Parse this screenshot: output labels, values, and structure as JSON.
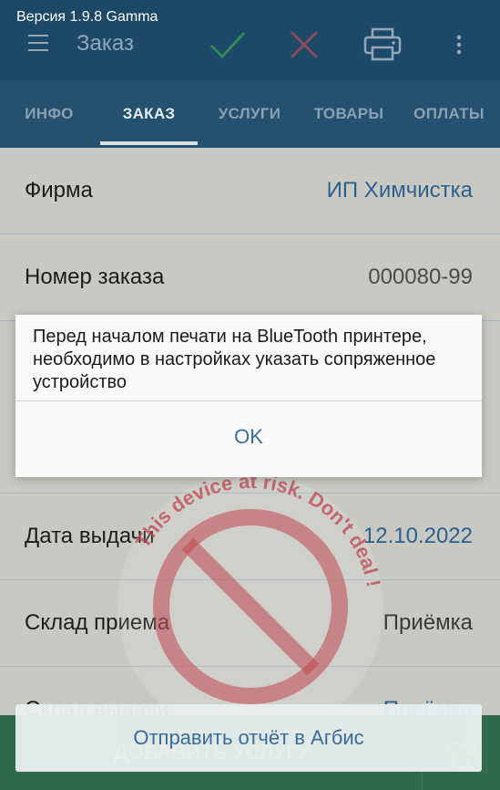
{
  "status": {
    "version_text": "Версия 1.9.8 Gamma"
  },
  "header": {
    "title": "Заказ"
  },
  "toolbar_icons": [
    "menu-icon",
    "check-icon",
    "close-icon",
    "print-icon",
    "more-vert-icon"
  ],
  "tabs": [
    {
      "label": "ИНФО",
      "active": false
    },
    {
      "label": "ЗАКАЗ",
      "active": true
    },
    {
      "label": "УСЛУГИ",
      "active": false
    },
    {
      "label": "ТОВАРЫ",
      "active": false
    },
    {
      "label": "ОПЛАТЫ",
      "active": false
    }
  ],
  "fields": [
    {
      "label": "Фирма",
      "value": "ИП Химчистка"
    },
    {
      "label": "Номер заказа",
      "value": "000080-99"
    },
    {
      "label": "Дата выдачи",
      "value": "12.10.2022"
    },
    {
      "label": "Склад приема",
      "value": "Приёмка"
    },
    {
      "label": "Склад выдачи",
      "value": "Приёмка"
    }
  ],
  "bottom": {
    "add_service_label": "ДОБАВИТЬ УСЛУГУ"
  },
  "toast": {
    "text": "Отправить отчёт в Агбис"
  },
  "dialog": {
    "message": "Перед началом печати на BlueTooth принтере, необходимо в настройках указать сопряженное устройство",
    "ok_label": "OK"
  },
  "watermark": {
    "text": "This device at risk. Don't deal !",
    "color": "#c0474e"
  },
  "colors": {
    "header_bg": "#1d4969",
    "accent_blue": "#3c6d98",
    "check_green": "#2f8a55",
    "close_red": "#c0474e"
  }
}
